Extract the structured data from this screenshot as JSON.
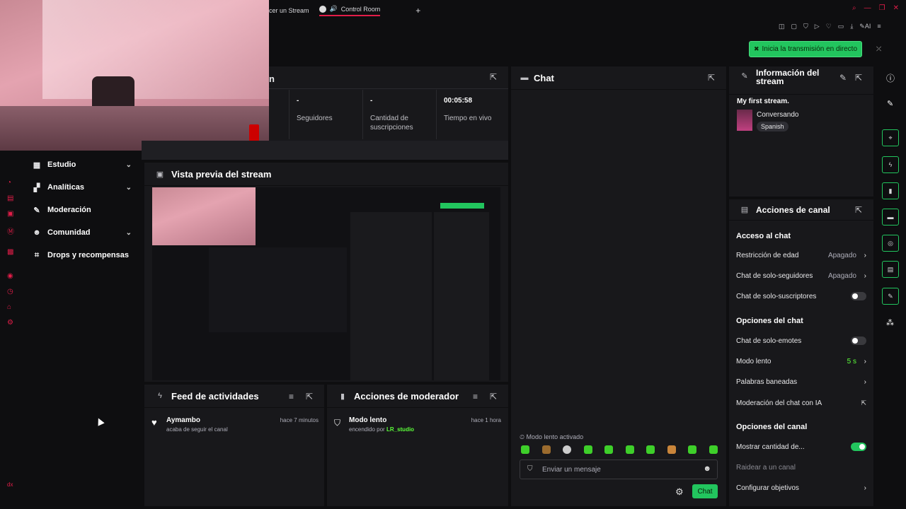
{
  "tabs": {
    "tab1_label": "cer un Stream",
    "tab2_label": "Control Room"
  },
  "go_live": {
    "label": "Inicia la transmisión en directo"
  },
  "sidebar": {
    "items": [
      {
        "label": "Estudio"
      },
      {
        "label": "Analíticas"
      },
      {
        "label": "Moderación"
      },
      {
        "label": "Comunidad"
      },
      {
        "label": "Drops y recompensas"
      }
    ],
    "bottom_label": "dx"
  },
  "stats": [
    {
      "value": "-",
      "label": "Seguidores"
    },
    {
      "value": "-",
      "label": "Cantidad de suscripciones"
    },
    {
      "value": "00:05:58",
      "label": "Tiempo en vivo"
    }
  ],
  "stats_panel_partial_title": "n",
  "preview": {
    "title": "Vista previa del stream"
  },
  "chat": {
    "title": "Chat",
    "slow_mode_notice": "Modo lento activado",
    "input_placeholder": "Enviar un mensaje",
    "send_label": "Chat"
  },
  "activity_feed": {
    "title": "Feed de actividades",
    "items": [
      {
        "user": "Aymambo",
        "action": "acaba de seguir el canal",
        "time": "hace 7 minutos"
      }
    ]
  },
  "mod_actions": {
    "title": "Acciones de moderador",
    "items": [
      {
        "title": "Modo lento",
        "by_prefix": "encendido por",
        "by_user": "LR_studio",
        "time": "hace 1 hora"
      }
    ]
  },
  "stream_info": {
    "title": "Información del stream",
    "stream_title": "My first stream.",
    "category": "Conversando",
    "language_tag": "Spanish"
  },
  "channel_actions": {
    "title": "Acciones de canal",
    "section_chat_access": "Acceso al chat",
    "age_restriction": {
      "label": "Restricción de edad",
      "value": "Apagado"
    },
    "followers_only": {
      "label": "Chat de solo-seguidores",
      "value": "Apagado"
    },
    "subs_only": {
      "label": "Chat de solo-suscriptores",
      "enabled": false
    },
    "section_chat_options": "Opciones del chat",
    "emotes_only": {
      "label": "Chat de solo-emotes",
      "enabled": false
    },
    "slow_mode": {
      "label": "Modo lento",
      "value": "5 s"
    },
    "banned_words": {
      "label": "Palabras baneadas"
    },
    "ai_moderation": {
      "label": "Moderación del chat con IA"
    },
    "section_channel_options": "Opciones del canal",
    "show_viewer_count": {
      "label": "Mostrar cantidad de...",
      "enabled": true
    },
    "raid": {
      "label": "Raidear a un canal"
    },
    "goals": {
      "label": "Configurar objetivos"
    }
  },
  "colors": {
    "accent_green": "#22c55e",
    "brand_red": "#e11d48",
    "panel_bg": "#18181b",
    "page_bg": "#0e0e10"
  }
}
